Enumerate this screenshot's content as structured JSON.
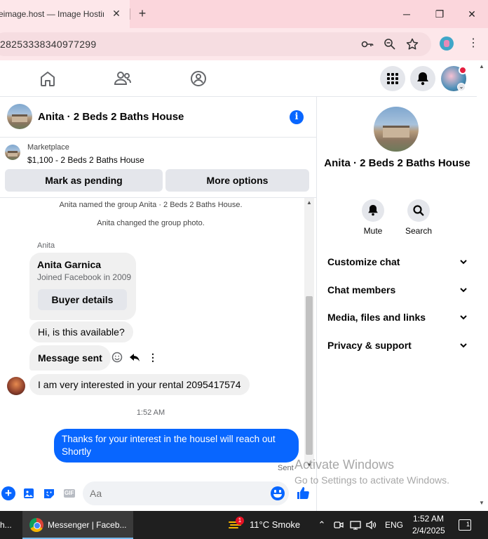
{
  "browser": {
    "tab_title": "eimage.host — Image Hosting",
    "tab_close": "✕",
    "new_tab": "+",
    "url": "28253338340977299",
    "win_minimize": "─",
    "win_restore": "❐",
    "win_close": "✕"
  },
  "chat": {
    "title": "Anita · 2 Beds 2 Baths House",
    "info": "i",
    "marketplace_label": "Marketplace",
    "listing": "$1,100 - 2 Beds 2 Baths House",
    "mark_pending": "Mark as pending",
    "more_options": "More options",
    "system_messages": [
      "Anita named the group Anita · 2 Beds 2 Baths House.",
      "Anita changed the group photo."
    ],
    "sender_name": "Anita",
    "profile_card": {
      "name": "Anita Garnica",
      "subtitle": "Joined Facebook in 2009",
      "button": "Buyer details"
    },
    "messages_in": [
      "Hi, is this available?",
      "Message sent",
      "I am very interested in your rental 2095417574"
    ],
    "timestamp": "1:52 AM",
    "message_out": "Thanks for your interest in the housel will reach out Shortly",
    "status": "Sent",
    "composer_placeholder": "Aa",
    "gif_label": "GIF"
  },
  "right_panel": {
    "title": "Anita · 2 Beds 2 Baths House",
    "mute_label": "Mute",
    "search_label": "Search",
    "sections": [
      "Customize chat",
      "Chat members",
      "Media, files and links",
      "Privacy & support"
    ]
  },
  "watermark": {
    "line1": "Activate Windows",
    "line2": "Go to Settings to activate Windows."
  },
  "taskbar": {
    "left_item": "h...",
    "app_label": "Messenger | Faceb...",
    "weather_badge": "1",
    "weather": "11°C  Smoke",
    "language": "ENG",
    "time": "1:52 AM",
    "date": "2/4/2025",
    "notif_count": "1"
  }
}
